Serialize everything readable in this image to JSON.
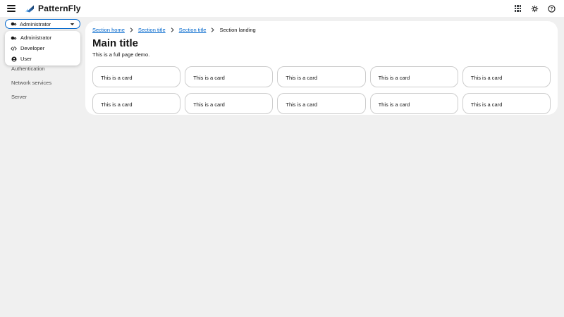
{
  "colors": {
    "accent": "#0066cc",
    "page_bg": "#f0f0f0",
    "surface": "#ffffff",
    "text": "#151515",
    "text_secondary": "#4d4d4d",
    "card_border": "#cdcdcd",
    "logo_blue_light": "#73bcf7",
    "logo_blue_dark": "#1a5fa8"
  },
  "header": {
    "brand_name": "PatternFly",
    "icons": [
      "hamburger-icon",
      "apps-grid-icon",
      "settings-gear-icon",
      "help-question-icon"
    ]
  },
  "sidebar": {
    "context_selector": {
      "selected_label": "Administrator",
      "selected_icon": "user-cog-icon",
      "caret_icon": "caret-down-icon",
      "options": [
        {
          "label": "Administrator",
          "icon": "user-cog-icon"
        },
        {
          "label": "Developer",
          "icon": "code-icon"
        },
        {
          "label": "User",
          "icon": "user-circle-icon"
        }
      ]
    },
    "nav_items": [
      {
        "label": "Authentication"
      },
      {
        "label": "Network services"
      },
      {
        "label": "Server"
      }
    ]
  },
  "main": {
    "breadcrumb": {
      "items": [
        {
          "label": "Section home",
          "type": "link"
        },
        {
          "label": "Section title",
          "type": "link"
        },
        {
          "label": "Section title",
          "type": "link"
        },
        {
          "label": "Section landing",
          "type": "current"
        }
      ],
      "separator_icon": "chevron-right-icon"
    },
    "title": "Main title",
    "description": "This is a full page demo.",
    "cards": [
      {
        "text": "This is a card"
      },
      {
        "text": "This is a card"
      },
      {
        "text": "This is a card"
      },
      {
        "text": "This is a card"
      },
      {
        "text": "This is a card"
      },
      {
        "text": "This is a card"
      },
      {
        "text": "This is a card"
      },
      {
        "text": "This is a card"
      },
      {
        "text": "This is a card"
      },
      {
        "text": "This is a card"
      }
    ]
  }
}
